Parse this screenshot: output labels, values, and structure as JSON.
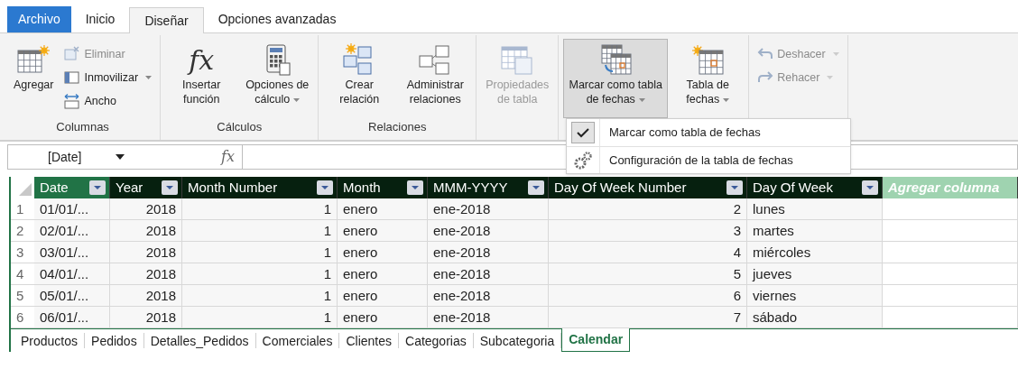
{
  "tabs": [
    {
      "label": "Archivo",
      "kind": "file",
      "selected": false
    },
    {
      "label": "Inicio",
      "kind": "tab",
      "selected": false
    },
    {
      "label": "Diseñar",
      "kind": "tab",
      "selected": true
    },
    {
      "label": "Opciones avanzadas",
      "kind": "tab",
      "selected": false
    }
  ],
  "ribbon": {
    "groups": [
      {
        "label": "Columnas",
        "buttons": [
          {
            "label": "Agregar",
            "kind": "large",
            "disabled": false,
            "dropdown": false,
            "pressed": false
          },
          {
            "label": "Eliminar",
            "kind": "small",
            "disabled": true,
            "dropdown": false,
            "pressed": false
          },
          {
            "label": "Inmovilizar",
            "kind": "small",
            "disabled": false,
            "dropdown": true,
            "pressed": false
          },
          {
            "label": "Ancho",
            "kind": "small",
            "disabled": false,
            "dropdown": false,
            "pressed": false
          }
        ]
      },
      {
        "label": "Cálculos",
        "buttons": [
          {
            "label": "Insertar función",
            "glyph": "fx",
            "kind": "large",
            "disabled": false,
            "dropdown": false,
            "pressed": false
          },
          {
            "label": "Opciones de cálculo",
            "kind": "large",
            "disabled": false,
            "dropdown": true,
            "pressed": false
          }
        ]
      },
      {
        "label": "Relaciones",
        "buttons": [
          {
            "label": "Crear relación",
            "kind": "large",
            "disabled": false,
            "dropdown": false,
            "pressed": false
          },
          {
            "label": "Administrar relaciones",
            "kind": "large",
            "disabled": false,
            "dropdown": false,
            "pressed": false
          }
        ]
      },
      {
        "buttons": [
          {
            "label": "Propiedades de tabla",
            "kind": "large",
            "disabled": true,
            "dropdown": false,
            "pressed": false
          }
        ]
      },
      {
        "buttons": [
          {
            "label": "Marcar como tabla de fechas",
            "kind": "large",
            "disabled": false,
            "dropdown": true,
            "pressed": true
          },
          {
            "label": "Tabla de fechas",
            "kind": "large",
            "disabled": false,
            "dropdown": true,
            "pressed": false
          }
        ]
      },
      {
        "buttons": [
          {
            "label": "Deshacer",
            "kind": "small",
            "disabled": true,
            "dropdown": true,
            "pressed": false
          },
          {
            "label": "Rehacer",
            "kind": "small",
            "disabled": true,
            "dropdown": true,
            "pressed": false
          }
        ]
      }
    ]
  },
  "menu": {
    "items": [
      {
        "label": "Marcar como tabla de fechas",
        "checked": true
      },
      {
        "label": "Configuración de la tabla de fechas",
        "checked": false
      }
    ]
  },
  "formula_bar": {
    "name_box": "[Date]",
    "fx": "fx"
  },
  "table": {
    "columns": [
      {
        "label": "Date",
        "kind": "text",
        "selected": true
      },
      {
        "label": "Year",
        "kind": "number",
        "selected": false
      },
      {
        "label": "Month Number",
        "kind": "number",
        "selected": false
      },
      {
        "label": "Month",
        "kind": "text",
        "selected": false
      },
      {
        "label": "MMM-YYYY",
        "kind": "text",
        "selected": false
      },
      {
        "label": "Day Of Week Number",
        "kind": "number",
        "selected": false
      },
      {
        "label": "Day Of Week",
        "kind": "text",
        "selected": false
      },
      {
        "label": "Agregar columna",
        "kind": "add",
        "selected": false
      }
    ],
    "rows": [
      {
        "number": "1",
        "cells": [
          "01/01/...",
          "2018",
          "1",
          "enero",
          "ene-2018",
          "2",
          "lunes"
        ]
      },
      {
        "number": "2",
        "cells": [
          "02/01/...",
          "2018",
          "1",
          "enero",
          "ene-2018",
          "3",
          "martes"
        ]
      },
      {
        "number": "3",
        "cells": [
          "03/01/...",
          "2018",
          "1",
          "enero",
          "ene-2018",
          "4",
          "miércoles"
        ]
      },
      {
        "number": "4",
        "cells": [
          "04/01/...",
          "2018",
          "1",
          "enero",
          "ene-2018",
          "5",
          "jueves"
        ]
      },
      {
        "number": "5",
        "cells": [
          "05/01/...",
          "2018",
          "1",
          "enero",
          "ene-2018",
          "6",
          "viernes"
        ]
      },
      {
        "number": "6",
        "cells": [
          "06/01/...",
          "2018",
          "1",
          "enero",
          "ene-2018",
          "7",
          "sábado"
        ]
      }
    ]
  },
  "sheet_tabs": [
    {
      "label": "Productos",
      "selected": false
    },
    {
      "label": "Pedidos",
      "selected": false
    },
    {
      "label": "Detalles_Pedidos",
      "selected": false
    },
    {
      "label": "Comerciales",
      "selected": false
    },
    {
      "label": "Clientes",
      "selected": false
    },
    {
      "label": "Categorias",
      "selected": false
    },
    {
      "label": "Subcategoria",
      "selected": false
    },
    {
      "label": "Calendar",
      "selected": true
    }
  ]
}
